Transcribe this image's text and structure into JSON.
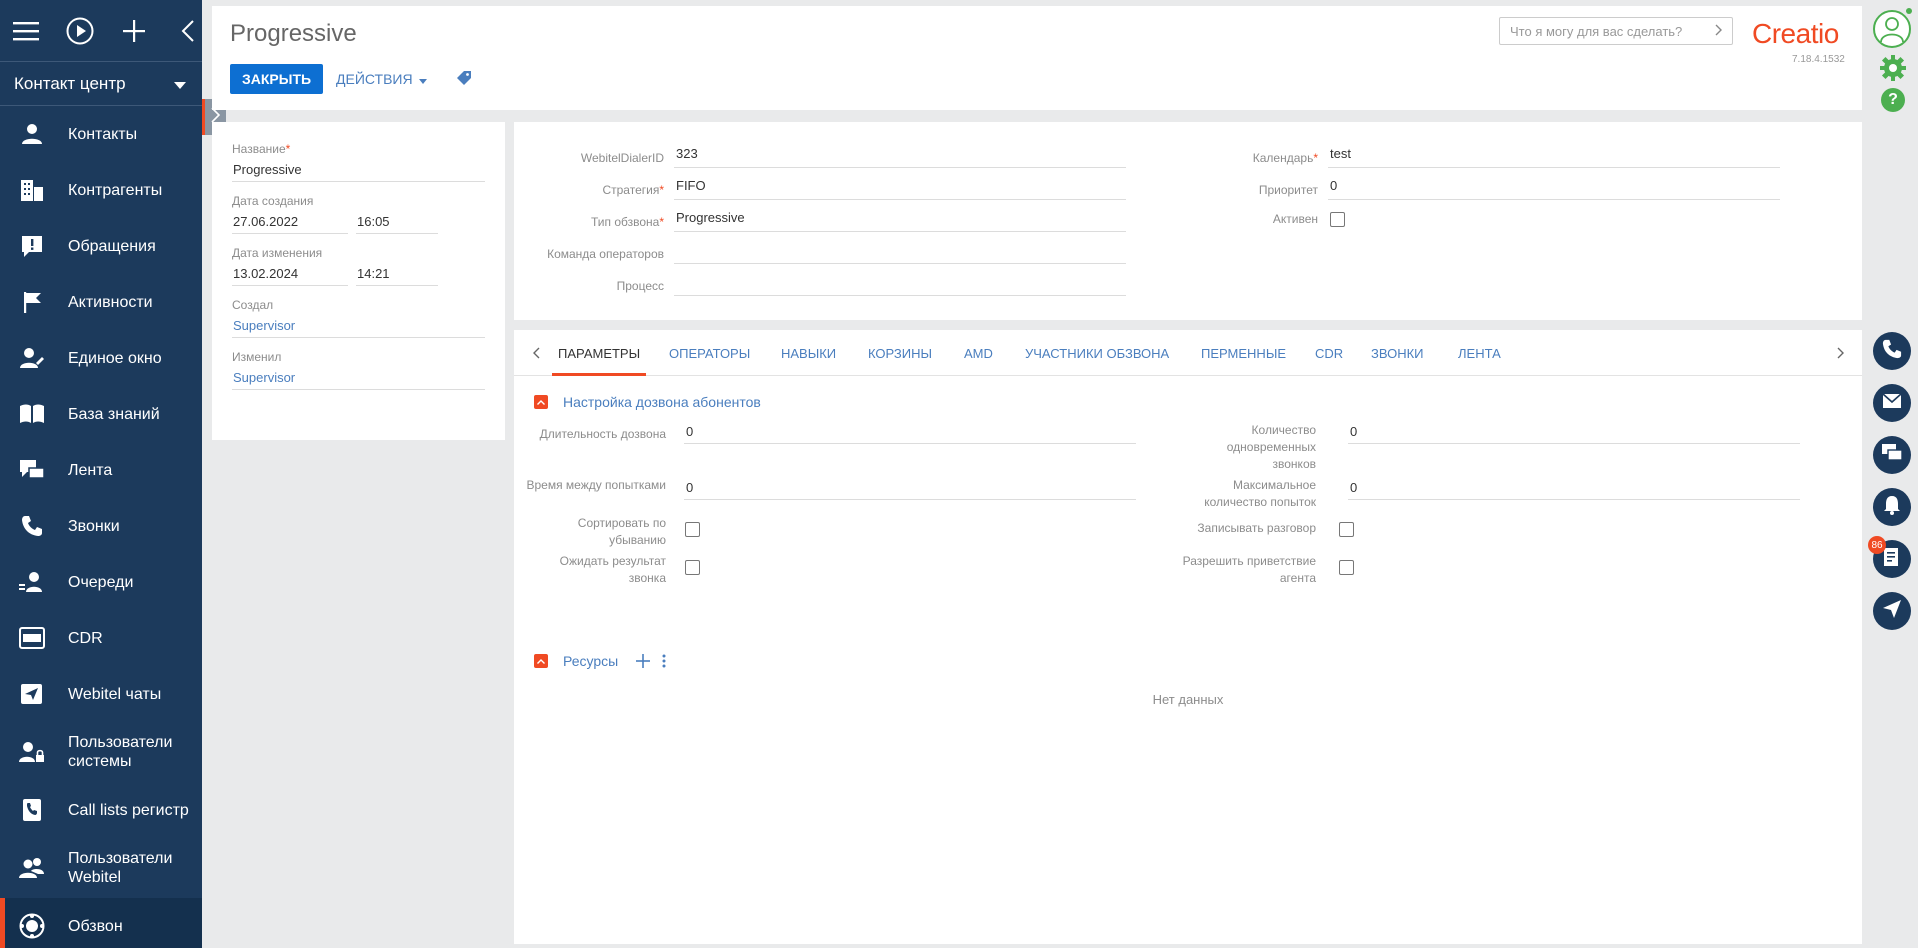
{
  "sidebar": {
    "workspace": "Контакт центр",
    "items": [
      {
        "label": "Контакты",
        "icon": "person-icon"
      },
      {
        "label": "Контрагенты",
        "icon": "building-icon"
      },
      {
        "label": "Обращения",
        "icon": "exclamation-icon"
      },
      {
        "label": "Активности",
        "icon": "flag-icon"
      },
      {
        "label": "Единое окно",
        "icon": "person-edit-icon"
      },
      {
        "label": "База знаний",
        "icon": "book-icon"
      },
      {
        "label": "Лента",
        "icon": "feed-icon"
      },
      {
        "label": "Звонки",
        "icon": "phone-icon"
      },
      {
        "label": "Очереди",
        "icon": "queue-icon"
      },
      {
        "label": "CDR",
        "icon": "cdr-icon"
      },
      {
        "label": "Webitel чаты",
        "icon": "send-icon"
      },
      {
        "label": "Пользователи системы",
        "icon": "user-lock-icon"
      },
      {
        "label": "Call lists регистр",
        "icon": "phone-book-icon"
      },
      {
        "label": "Пользователи Webitel",
        "icon": "users-icon"
      },
      {
        "label": "Обзвон",
        "icon": "dialer-icon"
      }
    ]
  },
  "header": {
    "title": "Progressive",
    "close_label": "ЗАКРЫТЬ",
    "actions_label": "ДЕЙСТВИЯ",
    "search_placeholder": "Что я могу для вас сделать?",
    "logo": "Creatio",
    "version": "7.18.4.1532"
  },
  "info": {
    "name_label": "Название",
    "name_value": "Progressive",
    "created_label": "Дата создания",
    "created_date": "27.06.2022",
    "created_time": "16:05",
    "modified_label": "Дата изменения",
    "modified_date": "13.02.2024",
    "modified_time": "14:21",
    "created_by_label": "Создал",
    "created_by": "Supervisor",
    "modified_by_label": "Изменил",
    "modified_by": "Supervisor"
  },
  "details": {
    "dialer_id_label": "WebitelDialerID",
    "dialer_id": "323",
    "strategy_label": "Стратегия",
    "strategy": "FIFO",
    "type_label": "Тип обзвона",
    "type": "Progressive",
    "team_label": "Команда операторов",
    "team": "",
    "process_label": "Процесс",
    "process": "",
    "calendar_label": "Календарь",
    "calendar": "test",
    "priority_label": "Приоритет",
    "priority": "0",
    "active_label": "Активен",
    "active": false
  },
  "tabs": [
    "ПАРАМЕТРЫ",
    "ОПЕРАТОРЫ",
    "НАВЫКИ",
    "КОРЗИНЫ",
    "AMD",
    "УЧАСТНИКИ ОБЗВОНА",
    "ПЕРМЕННЫЕ",
    "CDR",
    "ЗВОНКИ",
    "ЛЕНТА"
  ],
  "params": {
    "section_title": "Настройка дозвона абонентов",
    "duration_label": "Длительность дозвона",
    "duration": "0",
    "between_label": "Время между попытками",
    "between": "0",
    "sort_desc_label": "Сортировать по убыванию",
    "wait_result_label": "Ожидать результат звонка",
    "simultaneous_label": "Количество одновременных звонков",
    "simultaneous": "0",
    "max_attempts_label": "Максимальное количество попыток",
    "max_attempts": "0",
    "record_label": "Записывать разговор",
    "greeting_label": "Разрешить приветствие агента",
    "resources_title": "Ресурсы",
    "no_data": "Нет данных"
  },
  "rightbar": {
    "badge_count": "86"
  },
  "colors": {
    "sidebar": "#1c3a5c",
    "accent": "#f04a23",
    "primary_button": "#0d6fd2",
    "link": "#4a7ebe"
  }
}
